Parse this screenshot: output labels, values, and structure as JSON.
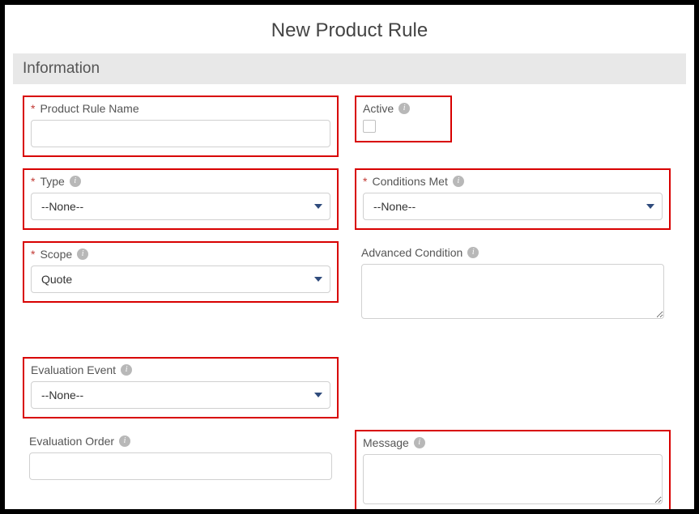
{
  "pageTitle": "New Product Rule",
  "sectionTitle": "Information",
  "fields": {
    "productRuleName": {
      "label": "Product Rule Name",
      "required": true,
      "value": ""
    },
    "active": {
      "label": "Active",
      "checked": false
    },
    "type": {
      "label": "Type",
      "required": true,
      "value": "--None--"
    },
    "conditionsMet": {
      "label": "Conditions Met",
      "required": true,
      "value": "--None--"
    },
    "scope": {
      "label": "Scope",
      "required": true,
      "value": "Quote"
    },
    "advancedCondition": {
      "label": "Advanced Condition",
      "value": ""
    },
    "evaluationEvent": {
      "label": "Evaluation Event",
      "value": "--None--"
    },
    "evaluationOrder": {
      "label": "Evaluation Order",
      "value": ""
    },
    "message": {
      "label": "Message",
      "value": ""
    }
  }
}
